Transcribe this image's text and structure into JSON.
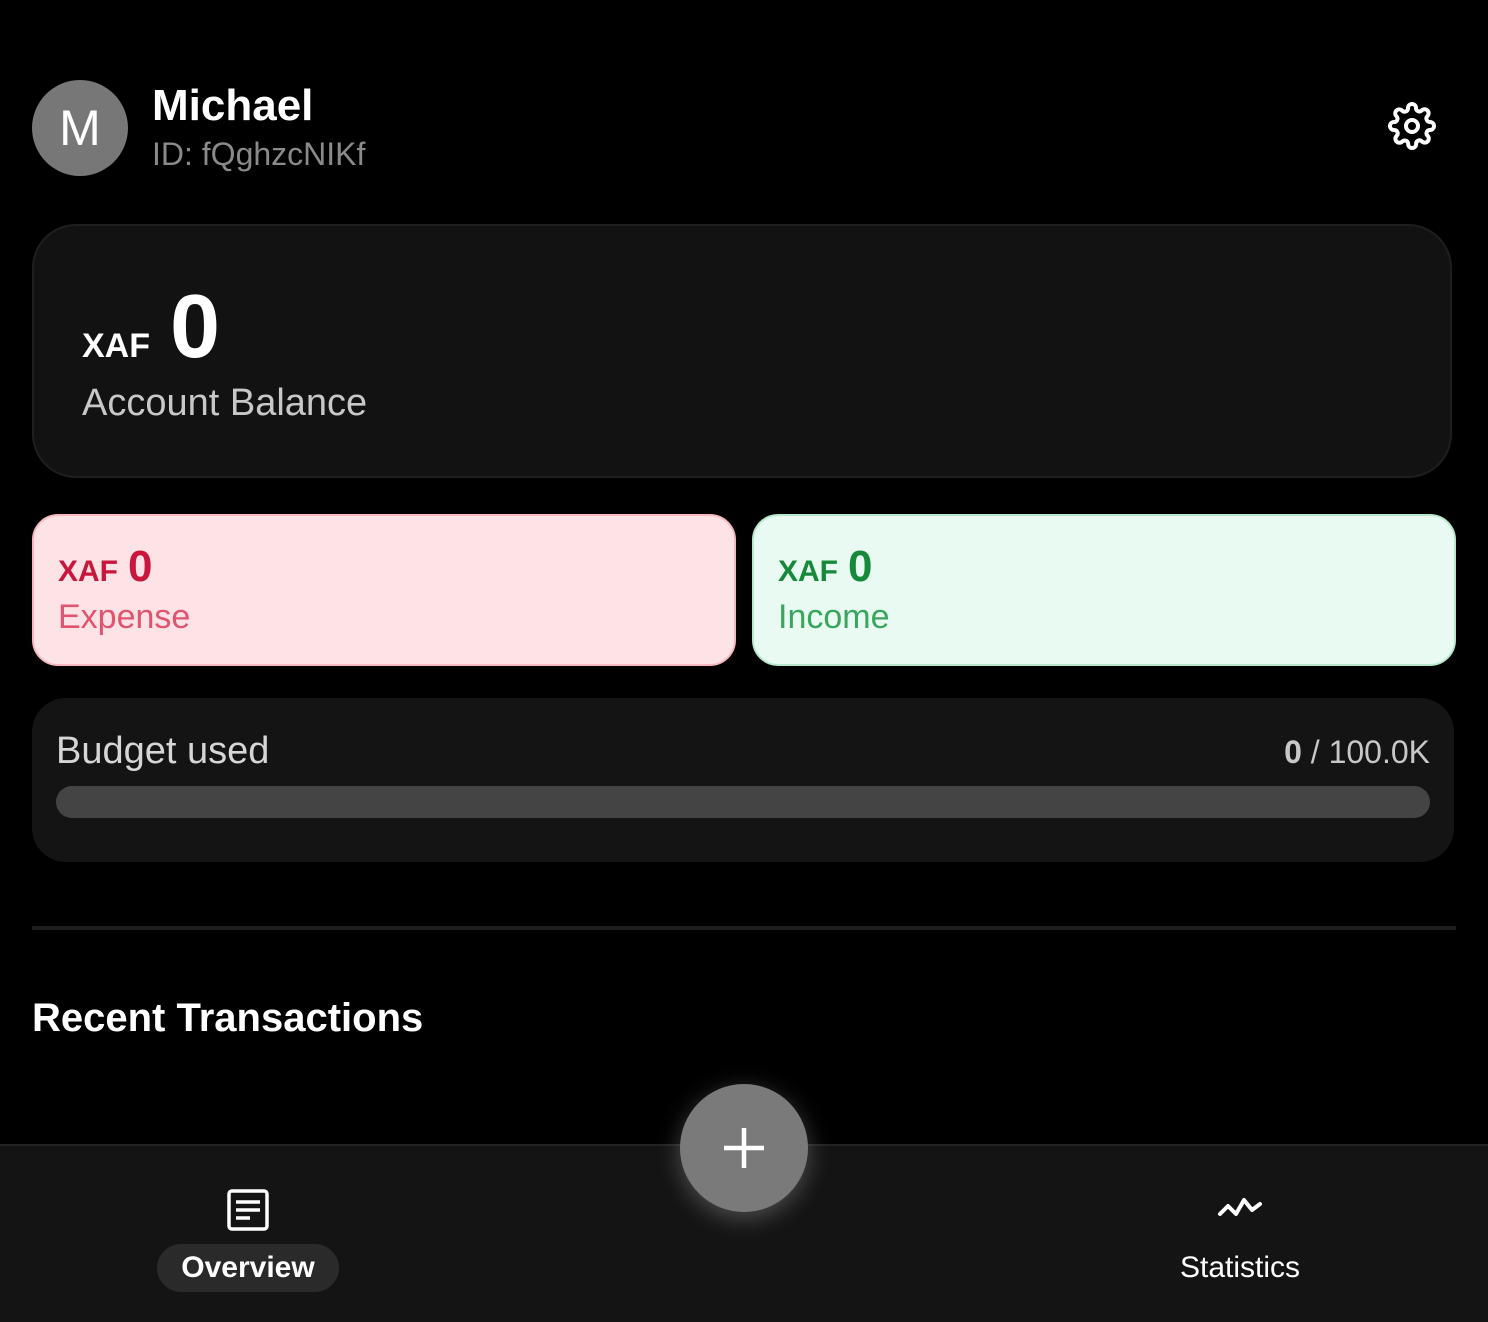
{
  "user": {
    "avatar_initial": "M",
    "name": "Michael",
    "id_label": "ID: fQghzcNIKf"
  },
  "balance": {
    "currency": "XAF",
    "amount": "0",
    "label": "Account Balance"
  },
  "expense": {
    "currency": "XAF",
    "amount": "0",
    "label": "Expense"
  },
  "income": {
    "currency": "XAF",
    "amount": "0",
    "label": "Income"
  },
  "budget": {
    "label": "Budget used",
    "used": "0",
    "separator": " / ",
    "total": "100.0K",
    "progress_fraction": 0
  },
  "recent_transactions": {
    "title": "Recent Transactions"
  },
  "nav": {
    "overview_label": "Overview",
    "statistics_label": "Statistics",
    "active": "overview"
  },
  "icons": {
    "settings": "gear-icon",
    "add": "plus-icon",
    "overview": "document-list-icon",
    "statistics": "line-chart-icon"
  },
  "colors": {
    "background": "#000000",
    "card": "#121212",
    "expense_bg": "#fde3e6",
    "expense_text": "#c8163c",
    "income_bg": "#e8faf1",
    "income_text": "#168a3a",
    "fab": "#7a7a7a"
  }
}
